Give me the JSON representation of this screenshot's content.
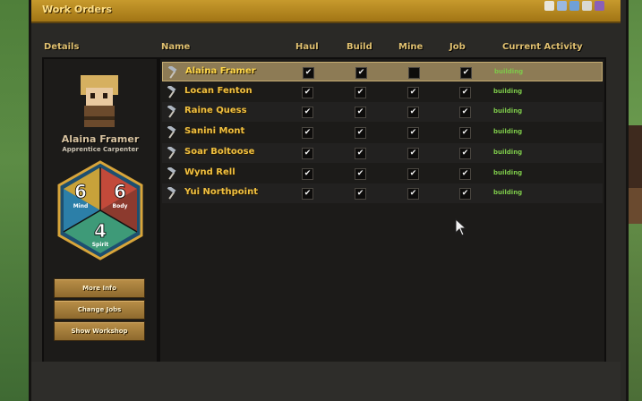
{
  "window": {
    "title": "Work Orders"
  },
  "headers": {
    "details": "Details",
    "name": "Name",
    "haul": "Haul",
    "build": "Build",
    "mine": "Mine",
    "job": "Job",
    "activity": "Current Activity"
  },
  "selected": {
    "name": "Alaina Framer",
    "title": "Apprentice Carpenter",
    "stats": {
      "mind": "6",
      "mind_label": "Mind",
      "body": "6",
      "body_label": "Body",
      "spirit": "4",
      "spirit_label": "Spirit"
    }
  },
  "buttons": {
    "more_info": "More Info",
    "change_jobs": "Change Jobs",
    "show_workshop": "Show Workshop"
  },
  "workers": [
    {
      "name": "Alaina Framer",
      "haul": true,
      "build": true,
      "mine": false,
      "job": true,
      "activity": "building",
      "selected": true
    },
    {
      "name": "Locan Fenton",
      "haul": true,
      "build": true,
      "mine": true,
      "job": true,
      "activity": "building"
    },
    {
      "name": "Raine Quess",
      "haul": true,
      "build": true,
      "mine": true,
      "job": true,
      "activity": "building"
    },
    {
      "name": "Sanini Mont",
      "haul": true,
      "build": true,
      "mine": true,
      "job": true,
      "activity": "building"
    },
    {
      "name": "Soar Boltoose",
      "haul": true,
      "build": true,
      "mine": true,
      "job": true,
      "activity": "building"
    },
    {
      "name": "Wynd Rell",
      "haul": true,
      "build": true,
      "mine": true,
      "job": true,
      "activity": "building"
    },
    {
      "name": "Yui Northpoint",
      "haul": true,
      "build": true,
      "mine": true,
      "job": true,
      "activity": "building"
    }
  ],
  "colors": {
    "accent": "#c79a2d",
    "activity": "#7dc94a",
    "name": "#f0c040"
  }
}
